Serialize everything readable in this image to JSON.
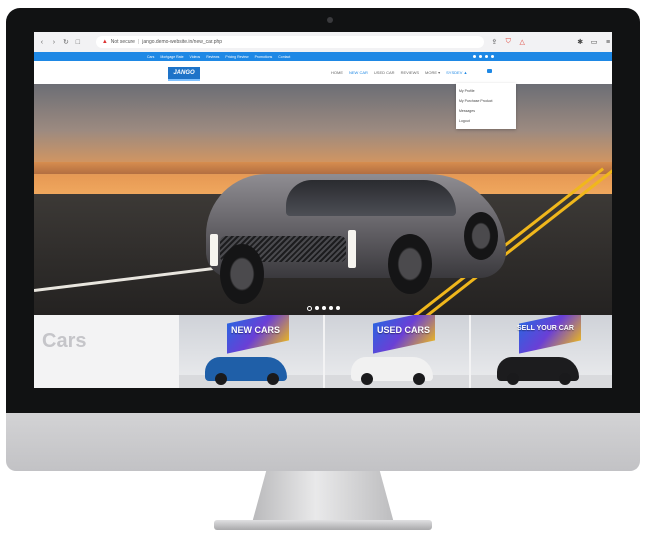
{
  "browser": {
    "security_label": "Not secure",
    "url": "jango.demo-website.in/new_car.php"
  },
  "topbar": {
    "links": [
      "Cars",
      "Mortgage Rate",
      "Videos",
      "Reviews",
      "Pricing Review",
      "Promotions",
      "Contact"
    ]
  },
  "site": {
    "logo": "JANGO",
    "nav": [
      {
        "label": "HOME"
      },
      {
        "label": "NEW CAR"
      },
      {
        "label": "USED CAR"
      },
      {
        "label": "REVIEWS"
      },
      {
        "label": "MORE ▾"
      },
      {
        "label": "SYSDEV ▲"
      }
    ]
  },
  "dropdown": {
    "items": [
      "My Profile",
      "My Purchase Product",
      "Messages",
      "Logout"
    ]
  },
  "hero": {
    "slide_dots": 5,
    "active_slide": 1
  },
  "section": {
    "title": "Cars",
    "tiles": [
      {
        "label": "NEW CARS",
        "car_color": "#1f5fa8"
      },
      {
        "label": "USED CARS",
        "car_color": "#f1f1f1"
      },
      {
        "label": "SELL YOUR CAR",
        "car_color": "#1c1c1e"
      }
    ]
  }
}
